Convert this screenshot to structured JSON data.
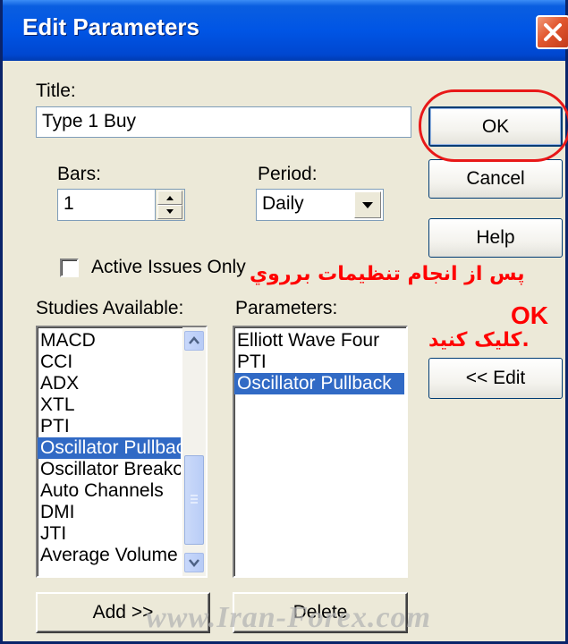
{
  "window": {
    "title": "Edit Parameters"
  },
  "fields": {
    "title_label": "Title:",
    "title_value": "Type 1 Buy",
    "bars_label": "Bars:",
    "bars_value": "1",
    "period_label": "Period:",
    "period_value": "Daily",
    "active_issues_label": "Active Issues Only",
    "active_issues_checked": false
  },
  "buttons": {
    "ok": "OK",
    "cancel": "Cancel",
    "help": "Help",
    "edit": "<< Edit",
    "add": "Add >>",
    "delete": "Delete"
  },
  "studies": {
    "label": "Studies Available:",
    "items": [
      "MACD",
      "CCI",
      "ADX",
      "XTL",
      "PTI",
      "Oscillator Pullback",
      "Oscillator Breakout",
      "Auto Channels",
      "DMI",
      "JTI",
      "Average Volume"
    ],
    "selected": "Oscillator Pullback"
  },
  "parameters": {
    "label": "Parameters:",
    "items": [
      "Elliott Wave Four",
      "PTI",
      "Oscillator Pullback"
    ],
    "selected": "Oscillator Pullback"
  },
  "annotation": {
    "line1": "پس از انجام تنظیمات برروي",
    "line2": "OK",
    "line3": "کلیک کنید.",
    "color": "#ff0000"
  },
  "watermark": "www.Iran-Forex.com",
  "colors": {
    "titlebar": "#0055e5",
    "selection": "#316ac5",
    "dialog_bg": "#ece9d8"
  }
}
